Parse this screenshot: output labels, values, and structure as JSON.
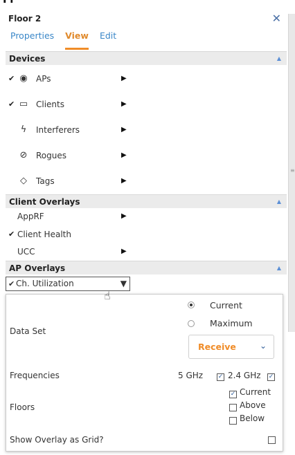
{
  "panel": {
    "title": "Floor 2",
    "partial_top_text": "Fl",
    "tabs": [
      {
        "label": "Properties",
        "active": false
      },
      {
        "label": "View",
        "active": true
      },
      {
        "label": "Edit",
        "active": false
      }
    ]
  },
  "devices": {
    "header": "Devices",
    "items": [
      {
        "label": "APs",
        "checked": true,
        "icon": "ap-icon",
        "glyph": "◉"
      },
      {
        "label": "Clients",
        "checked": true,
        "icon": "monitor-icon",
        "glyph": "▭"
      },
      {
        "label": "Interferers",
        "checked": false,
        "icon": "interferer-icon",
        "glyph": "ϟ"
      },
      {
        "label": "Rogues",
        "checked": false,
        "icon": "rogue-icon",
        "glyph": "⊘"
      },
      {
        "label": "Tags",
        "checked": false,
        "icon": "tag-icon",
        "glyph": "◇"
      }
    ]
  },
  "client_overlays": {
    "header": "Client Overlays",
    "items": [
      {
        "label": "AppRF",
        "checked": false,
        "has_arrow": true
      },
      {
        "label": "Client Health",
        "checked": true,
        "has_arrow": false
      },
      {
        "label": "UCC",
        "checked": false,
        "has_arrow": true
      }
    ]
  },
  "ap_overlays": {
    "header": "AP Overlays",
    "selected": "Ch. Utilization",
    "caret": "▼",
    "check": "✔"
  },
  "overlay_settings": {
    "data_set_label": "Data Set",
    "data_set_options": [
      {
        "label": "Current",
        "selected": true
      },
      {
        "label": "Maximum",
        "selected": false
      }
    ],
    "direction": "Receive",
    "frequencies_label": "Frequencies",
    "frequencies": [
      {
        "label": "5 GHz",
        "checked": true
      },
      {
        "label": "2.4 GHz",
        "checked": true
      }
    ],
    "floors_label": "Floors",
    "floors": [
      {
        "label": "Current",
        "checked": true
      },
      {
        "label": "Above",
        "checked": false
      },
      {
        "label": "Below",
        "checked": false
      }
    ],
    "grid_label": "Show Overlay as Grid?",
    "grid_checked": false
  },
  "colors": {
    "accent": "#f08c28",
    "link": "#3a87c8",
    "header_bg": "#ebebeb"
  }
}
